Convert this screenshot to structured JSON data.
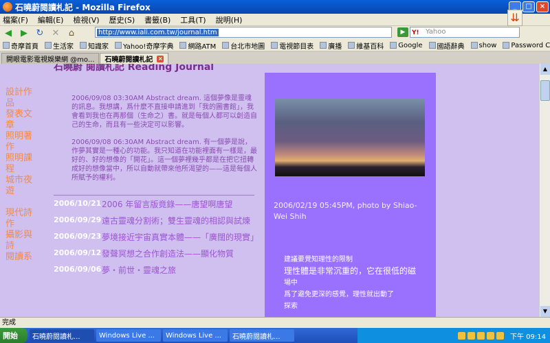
{
  "window": {
    "title": "石曉蔚閱讀札記 - Mozilla Firefox"
  },
  "menu": [
    "檔案(F)",
    "編輯(E)",
    "檢視(V)",
    "歷史(S)",
    "書籤(B)",
    "工具(T)",
    "說明(H)"
  ],
  "nav": {
    "url": "http://www.iali.com.tw/journal.htm",
    "search_placeholder": "Yahoo"
  },
  "bookmarks": [
    "奇摩首頁",
    "生活家",
    "知識家",
    "Yahoo!奇摩字典",
    "網路ATM",
    "台北市地圖",
    "電視節目表",
    "廣播",
    "維基百科",
    "Google",
    "國語辭典",
    "show",
    "Password Chart"
  ],
  "tabs": [
    {
      "label": "開眼電影電視娛樂網 @mo..."
    },
    {
      "label": "石曉蔚閱讀札記"
    }
  ],
  "page": {
    "header": "石曉蔚 閱讀札記 Reading Journal",
    "left_nav": [
      "設計作",
      "品",
      "發表文",
      "章",
      "照明著",
      "作",
      "照明課",
      "程",
      "城市夜",
      "遊",
      "",
      "現代詩",
      "作",
      "攝影與",
      "詩",
      "閱讀系"
    ],
    "entries": [
      "2006/09/08 03:30AM Abstract dream. 這個夢像是靈魂的訊息。我想講，爲什麼不直接申請進到「我的圖書館」，我會看到我也在再那個（生命之）書。就是每個人都可以創造自己的生命，而且有一些決定可以影響。",
      "2006/09/08 06:30AM Abstract dream. 有一個夢是說，作夢其實是一種心的功能。我只知道在功能裡面有一樣是，最好的、好的想像的「開花」。這一個夢裡幾乎都是在把它扭轉成好的想像當中，所以自動就帶來他所渴望的——這是每個人所賦予的權利。"
    ],
    "posts": [
      {
        "date": "2006/10/21",
        "title": "2006 年留言版竟錄——唐望啊唐望"
      },
      {
        "date": "2006/09/29",
        "title": "遠古靈魂分割術；雙生靈魂的相認與試煉"
      },
      {
        "date": "2006/09/23",
        "title": "夢境接近宇宙真實本體——「廣闊的現實」"
      },
      {
        "date": "2006/09/12",
        "title": "發聲冥想之合作創造法——顯化物質"
      },
      {
        "date": "2006/09/06",
        "title": "夢・前世・靈魂之旅"
      }
    ],
    "photo_caption": "2006/02/19 05:45PM, photo by Shiao-Wei Shih",
    "quote": [
      "建議要覺知理性的限制",
      "理性體是非常沉重的，它在很低的磁",
      "場中",
      "爲了避免更深的感覺，理性就出動了",
      "探索"
    ]
  },
  "status": "完成",
  "taskbar": {
    "start": "開始",
    "items": [
      "石曉蔚閱讀札...",
      "Windows Live ...",
      "Windows Live ...",
      "石曉蔚閱讀札..."
    ],
    "clock": "下午 09:14"
  }
}
